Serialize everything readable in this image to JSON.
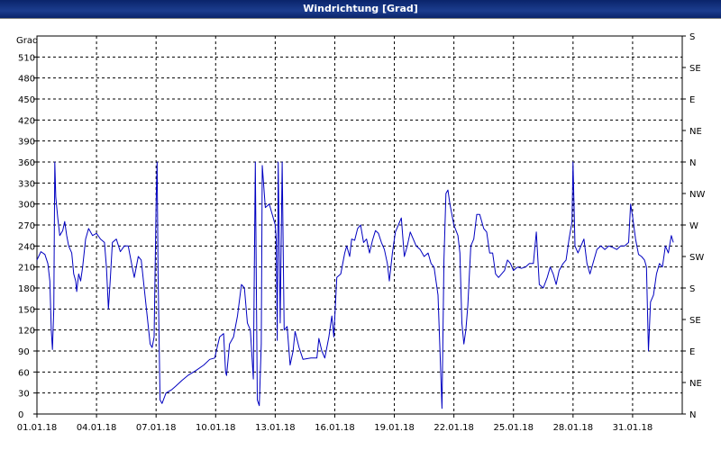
{
  "window": {
    "title": "Windrichtung [Grad]"
  },
  "chart_data": {
    "type": "line",
    "title": "Windrichtung [Grad]",
    "ylabel": "Grad",
    "ylim": [
      0,
      540
    ],
    "y_ticks": [
      0,
      30,
      60,
      90,
      120,
      150,
      180,
      210,
      240,
      270,
      300,
      330,
      360,
      390,
      420,
      450,
      480,
      510
    ],
    "right_axis_labels": [
      "N",
      "NE",
      "E",
      "SE",
      "S",
      "SW",
      "W",
      "NW",
      "N",
      "NE",
      "E",
      "SE",
      "S"
    ],
    "x_tick_labels": [
      "01.01.18",
      "04.01.18",
      "07.01.18",
      "10.01.18",
      "13.01.18",
      "16.01.18",
      "19.01.18",
      "22.01.18",
      "25.01.18",
      "28.01.18",
      "31.01.18"
    ],
    "xlim_days": [
      0,
      32.5
    ],
    "grid": true,
    "series": [
      {
        "color": "#0000c0",
        "points": [
          [
            0.0,
            220
          ],
          [
            0.2,
            232
          ],
          [
            0.4,
            228
          ],
          [
            0.55,
            215
          ],
          [
            0.65,
            190
          ],
          [
            0.72,
            120
          ],
          [
            0.78,
            92
          ],
          [
            0.85,
            150
          ],
          [
            0.9,
            360
          ],
          [
            0.95,
            310
          ],
          [
            1.05,
            280
          ],
          [
            1.15,
            255
          ],
          [
            1.3,
            262
          ],
          [
            1.4,
            275
          ],
          [
            1.5,
            255
          ],
          [
            1.6,
            240
          ],
          [
            1.75,
            230
          ],
          [
            1.85,
            200
          ],
          [
            1.95,
            190
          ],
          [
            2.0,
            175
          ],
          [
            2.1,
            200
          ],
          [
            2.2,
            190
          ],
          [
            2.3,
            210
          ],
          [
            2.45,
            250
          ],
          [
            2.6,
            265
          ],
          [
            2.8,
            255
          ],
          [
            3.0,
            258
          ],
          [
            3.2,
            250
          ],
          [
            3.4,
            245
          ],
          [
            3.5,
            210
          ],
          [
            3.6,
            150
          ],
          [
            3.7,
            195
          ],
          [
            3.8,
            245
          ],
          [
            4.0,
            250
          ],
          [
            4.2,
            232
          ],
          [
            4.4,
            240
          ],
          [
            4.6,
            240
          ],
          [
            4.8,
            210
          ],
          [
            4.9,
            195
          ],
          [
            5.0,
            210
          ],
          [
            5.1,
            225
          ],
          [
            5.25,
            220
          ],
          [
            5.4,
            180
          ],
          [
            5.55,
            140
          ],
          [
            5.7,
            100
          ],
          [
            5.8,
            95
          ],
          [
            5.9,
            110
          ],
          [
            6.0,
            300
          ],
          [
            6.05,
            360
          ],
          [
            6.1,
            200
          ],
          [
            6.2,
            20
          ],
          [
            6.3,
            15
          ],
          [
            6.5,
            30
          ],
          [
            6.8,
            35
          ],
          [
            7.0,
            40
          ],
          [
            7.3,
            48
          ],
          [
            7.6,
            55
          ],
          [
            8.0,
            62
          ],
          [
            8.4,
            70
          ],
          [
            8.7,
            78
          ],
          [
            8.95,
            80
          ],
          [
            9.2,
            110
          ],
          [
            9.4,
            115
          ],
          [
            9.5,
            60
          ],
          [
            9.55,
            55
          ],
          [
            9.7,
            100
          ],
          [
            9.9,
            110
          ],
          [
            10.1,
            140
          ],
          [
            10.3,
            185
          ],
          [
            10.45,
            180
          ],
          [
            10.6,
            130
          ],
          [
            10.75,
            120
          ],
          [
            10.9,
            50
          ],
          [
            11.0,
            360
          ],
          [
            11.1,
            20
          ],
          [
            11.2,
            12
          ],
          [
            11.3,
            100
          ],
          [
            11.35,
            355
          ],
          [
            11.5,
            295
          ],
          [
            11.7,
            300
          ],
          [
            11.9,
            280
          ],
          [
            12.0,
            270
          ],
          [
            12.05,
            250
          ],
          [
            12.1,
            105
          ],
          [
            12.15,
            360
          ],
          [
            12.25,
            130
          ],
          [
            12.35,
            360
          ],
          [
            12.45,
            120
          ],
          [
            12.6,
            125
          ],
          [
            12.75,
            70
          ],
          [
            12.9,
            90
          ],
          [
            13.0,
            118
          ],
          [
            13.2,
            95
          ],
          [
            13.4,
            78
          ],
          [
            13.8,
            80
          ],
          [
            14.1,
            80
          ],
          [
            14.2,
            108
          ],
          [
            14.35,
            90
          ],
          [
            14.5,
            80
          ],
          [
            14.7,
            110
          ],
          [
            14.85,
            140
          ],
          [
            14.95,
            110
          ],
          [
            15.1,
            195
          ],
          [
            15.3,
            200
          ],
          [
            15.5,
            230
          ],
          [
            15.6,
            240
          ],
          [
            15.75,
            225
          ],
          [
            15.85,
            250
          ],
          [
            16.0,
            248
          ],
          [
            16.15,
            265
          ],
          [
            16.3,
            270
          ],
          [
            16.45,
            245
          ],
          [
            16.6,
            250
          ],
          [
            16.75,
            230
          ],
          [
            16.9,
            248
          ],
          [
            17.05,
            262
          ],
          [
            17.2,
            258
          ],
          [
            17.35,
            245
          ],
          [
            17.5,
            235
          ],
          [
            17.65,
            215
          ],
          [
            17.75,
            190
          ],
          [
            17.9,
            230
          ],
          [
            18.05,
            260
          ],
          [
            18.2,
            270
          ],
          [
            18.35,
            280
          ],
          [
            18.5,
            225
          ],
          [
            18.65,
            240
          ],
          [
            18.8,
            260
          ],
          [
            18.95,
            250
          ],
          [
            19.1,
            240
          ],
          [
            19.3,
            235
          ],
          [
            19.5,
            225
          ],
          [
            19.7,
            230
          ],
          [
            19.85,
            215
          ],
          [
            20.0,
            210
          ],
          [
            20.2,
            170
          ],
          [
            20.3,
            90
          ],
          [
            20.4,
            8
          ],
          [
            20.5,
            220
          ],
          [
            20.6,
            315
          ],
          [
            20.7,
            320
          ],
          [
            20.8,
            300
          ],
          [
            21.0,
            270
          ],
          [
            21.2,
            255
          ],
          [
            21.3,
            230
          ],
          [
            21.4,
            130
          ],
          [
            21.5,
            100
          ],
          [
            21.6,
            120
          ],
          [
            21.7,
            155
          ],
          [
            21.85,
            240
          ],
          [
            22.0,
            250
          ],
          [
            22.15,
            285
          ],
          [
            22.3,
            285
          ],
          [
            22.5,
            265
          ],
          [
            22.65,
            260
          ],
          [
            22.8,
            230
          ],
          [
            22.95,
            230
          ],
          [
            23.1,
            200
          ],
          [
            23.25,
            195
          ],
          [
            23.4,
            200
          ],
          [
            23.55,
            205
          ],
          [
            23.7,
            220
          ],
          [
            23.85,
            215
          ],
          [
            24.0,
            205
          ],
          [
            24.2,
            210
          ],
          [
            24.4,
            208
          ],
          [
            24.6,
            210
          ],
          [
            24.8,
            215
          ],
          [
            25.0,
            215
          ],
          [
            25.15,
            260
          ],
          [
            25.3,
            185
          ],
          [
            25.5,
            180
          ],
          [
            25.7,
            195
          ],
          [
            25.85,
            210
          ],
          [
            26.0,
            200
          ],
          [
            26.15,
            185
          ],
          [
            26.3,
            205
          ],
          [
            26.5,
            215
          ],
          [
            26.65,
            220
          ],
          [
            26.8,
            250
          ],
          [
            26.95,
            275
          ],
          [
            27.0,
            360
          ],
          [
            27.1,
            240
          ],
          [
            27.25,
            230
          ],
          [
            27.4,
            240
          ],
          [
            27.55,
            250
          ],
          [
            27.7,
            215
          ],
          [
            27.85,
            200
          ],
          [
            28.0,
            215
          ],
          [
            28.2,
            235
          ],
          [
            28.4,
            240
          ],
          [
            28.6,
            235
          ],
          [
            28.8,
            240
          ],
          [
            29.0,
            238
          ],
          [
            29.2,
            235
          ],
          [
            29.4,
            240
          ],
          [
            29.6,
            240
          ],
          [
            29.8,
            245
          ],
          [
            29.9,
            300
          ],
          [
            30.0,
            282
          ],
          [
            30.15,
            250
          ],
          [
            30.3,
            228
          ],
          [
            30.45,
            225
          ],
          [
            30.6,
            220
          ],
          [
            30.7,
            210
          ],
          [
            30.8,
            90
          ],
          [
            30.9,
            160
          ],
          [
            31.05,
            170
          ],
          [
            31.2,
            200
          ],
          [
            31.35,
            215
          ],
          [
            31.5,
            210
          ],
          [
            31.65,
            240
          ],
          [
            31.8,
            230
          ],
          [
            31.95,
            255
          ],
          [
            32.05,
            245
          ]
        ]
      }
    ]
  }
}
